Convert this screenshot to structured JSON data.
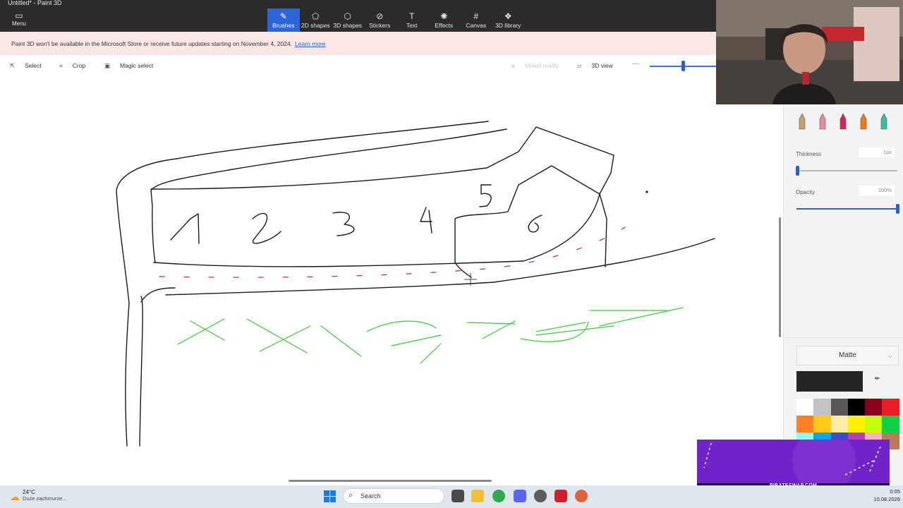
{
  "window": {
    "title": "Untitled* - Paint 3D"
  },
  "ribbon": {
    "menu_label": "Menu",
    "tabs": [
      {
        "label": "Brushes",
        "icon": "brush-icon",
        "glyph": "✎",
        "active": true
      },
      {
        "label": "2D shapes",
        "icon": "2d-shapes-icon",
        "glyph": "⬠",
        "active": false
      },
      {
        "label": "3D shapes",
        "icon": "3d-shapes-icon",
        "glyph": "⬡",
        "active": false
      },
      {
        "label": "Stickers",
        "icon": "stickers-icon",
        "glyph": "⊘",
        "active": false
      },
      {
        "label": "Text",
        "icon": "text-icon",
        "glyph": "T",
        "active": false
      },
      {
        "label": "Effects",
        "icon": "effects-icon",
        "glyph": "✺",
        "active": false
      },
      {
        "label": "Canvas",
        "icon": "canvas-icon",
        "glyph": "#",
        "active": false
      },
      {
        "label": "3D library",
        "icon": "3d-library-icon",
        "glyph": "❖",
        "active": false
      }
    ]
  },
  "banner": {
    "message": "Paint 3D won't be available in the Microsoft Store or receive future updates starting on November 4, 2024.",
    "link": "Learn more"
  },
  "toolbar": {
    "select": "Select",
    "crop": "Crop",
    "magic_select": "Magic select",
    "mixed_reality": "Mixed reality",
    "view_3d": "3D view"
  },
  "canvas": {
    "numbers": [
      "1",
      "2",
      "3",
      "4",
      "5",
      "6"
    ],
    "ink_colors": {
      "black": "#1a1a1a",
      "red": "#c2283c",
      "green": "#3ec93b"
    }
  },
  "panel": {
    "thickness_label": "Thickness",
    "thickness_value": "1px",
    "thickness_level": 0.01,
    "opacity_label": "Opacity",
    "opacity_value": "100%",
    "opacity_level": 1.0,
    "finish": "Matte",
    "current_color": "#252525",
    "brushes": [
      {
        "name": "marker-icon",
        "color": "#c8a070"
      },
      {
        "name": "calligraphy-pen-icon",
        "color": "#e98aa0"
      },
      {
        "name": "oil-brush-icon",
        "color": "#d6245a"
      },
      {
        "name": "watercolor-icon",
        "color": "#f07a1a"
      },
      {
        "name": "pixel-pen-icon",
        "color": "#34c0a0"
      }
    ],
    "palette": [
      "#ffffff",
      "#c3c3c3",
      "#585858",
      "#000000",
      "#88001b",
      "#ec1c24",
      "#ff7f27",
      "#ffca18",
      "#fdeca6",
      "#fff200",
      "#c4ff0e",
      "#0ed145",
      "#8cfffb",
      "#00a8f3",
      "#3f48cc",
      "#b83dba",
      "#ffaec8",
      "#b97a56"
    ]
  },
  "overlay": {
    "promo_text": "PIRATESWAP.COM"
  },
  "taskbar": {
    "temperature": "24°C",
    "weather_desc": "Duże zachmurze...",
    "search_placeholder": "Search",
    "time": "0:05",
    "date": "10.08.2026"
  }
}
